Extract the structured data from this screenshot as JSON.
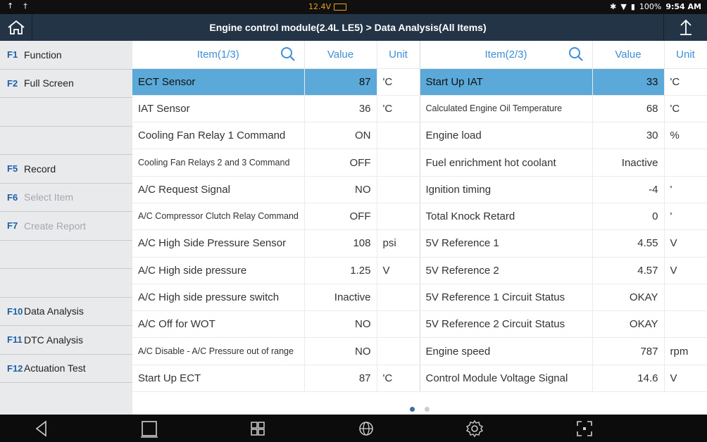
{
  "status": {
    "voltage": "12.4V",
    "battery": "100%",
    "time": "9:54 AM"
  },
  "header": {
    "title": "Engine control module(2.4L LE5)  >  Data Analysis(All Items)"
  },
  "sidebar": {
    "items": [
      {
        "key": "F1",
        "label": "Function",
        "disabled": false
      },
      {
        "key": "F2",
        "label": "Full Screen",
        "disabled": false
      },
      {
        "key": "",
        "label": "",
        "disabled": false
      },
      {
        "key": "",
        "label": "",
        "disabled": false
      },
      {
        "key": "F5",
        "label": "Record",
        "disabled": false
      },
      {
        "key": "F6",
        "label": "Select Item",
        "disabled": true
      },
      {
        "key": "F7",
        "label": "Create Report",
        "disabled": true
      },
      {
        "key": "",
        "label": "",
        "disabled": false
      },
      {
        "key": "",
        "label": "",
        "disabled": false
      },
      {
        "key": "F10",
        "label": "Data Analysis",
        "disabled": false
      },
      {
        "key": "F11",
        "label": "DTC Analysis",
        "disabled": false
      },
      {
        "key": "F12",
        "label": "Actuation Test",
        "disabled": false
      }
    ]
  },
  "table": {
    "headers": {
      "item1": "Item(1/3)",
      "value1": "Value",
      "unit1": "Unit",
      "item2": "Item(2/3)",
      "value2": "Value",
      "unit2": "Unit"
    },
    "rows": [
      {
        "n1": "ECT Sensor",
        "v1": "87",
        "u1": "'C",
        "n2": "Start Up IAT",
        "v2": "33",
        "u2": "'C",
        "selected": true
      },
      {
        "n1": "IAT Sensor",
        "v1": "36",
        "u1": "'C",
        "n2": "Calculated Engine Oil Temperature",
        "v2": "68",
        "u2": "'C"
      },
      {
        "n1": "Cooling Fan Relay 1 Command",
        "v1": "ON",
        "u1": "",
        "n2": "Engine load",
        "v2": "30",
        "u2": "%"
      },
      {
        "n1": "Cooling Fan Relays 2 and 3 Command",
        "v1": "OFF",
        "u1": "",
        "n2": "Fuel enrichment hot coolant",
        "v2": "Inactive",
        "u2": ""
      },
      {
        "n1": "A/C Request Signal",
        "v1": "NO",
        "u1": "",
        "n2": "Ignition timing",
        "v2": "-4",
        "u2": "'"
      },
      {
        "n1": "A/C Compressor Clutch Relay Command",
        "v1": "OFF",
        "u1": "",
        "n2": "Total Knock Retard",
        "v2": "0",
        "u2": "'"
      },
      {
        "n1": "A/C High Side Pressure Sensor",
        "v1": "108",
        "u1": "psi",
        "n2": "5V Reference 1",
        "v2": "4.55",
        "u2": "V"
      },
      {
        "n1": "A/C High side pressure",
        "v1": "1.25",
        "u1": "V",
        "n2": "5V Reference 2",
        "v2": "4.57",
        "u2": "V"
      },
      {
        "n1": "A/C High side pressure switch",
        "v1": "Inactive",
        "u1": "",
        "n2": "5V Reference 1 Circuit Status",
        "v2": "OKAY",
        "u2": ""
      },
      {
        "n1": "A/C Off for WOT",
        "v1": "NO",
        "u1": "",
        "n2": "5V Reference 2 Circuit Status",
        "v2": "OKAY",
        "u2": ""
      },
      {
        "n1": "A/C Disable - A/C Pressure out of range",
        "v1": "NO",
        "u1": "",
        "n2": "Engine speed",
        "v2": "787",
        "u2": "rpm"
      },
      {
        "n1": "Start Up ECT",
        "v1": "87",
        "u1": "'C",
        "n2": "Control Module Voltage Signal",
        "v2": "14.6",
        "u2": "V"
      }
    ]
  },
  "pager": {
    "pages": 2,
    "current": 1
  },
  "colors": {
    "header": "#243447",
    "accent": "#3d8fd8",
    "selected": "#5aa9d8",
    "sidebar": "#e9eaec"
  }
}
